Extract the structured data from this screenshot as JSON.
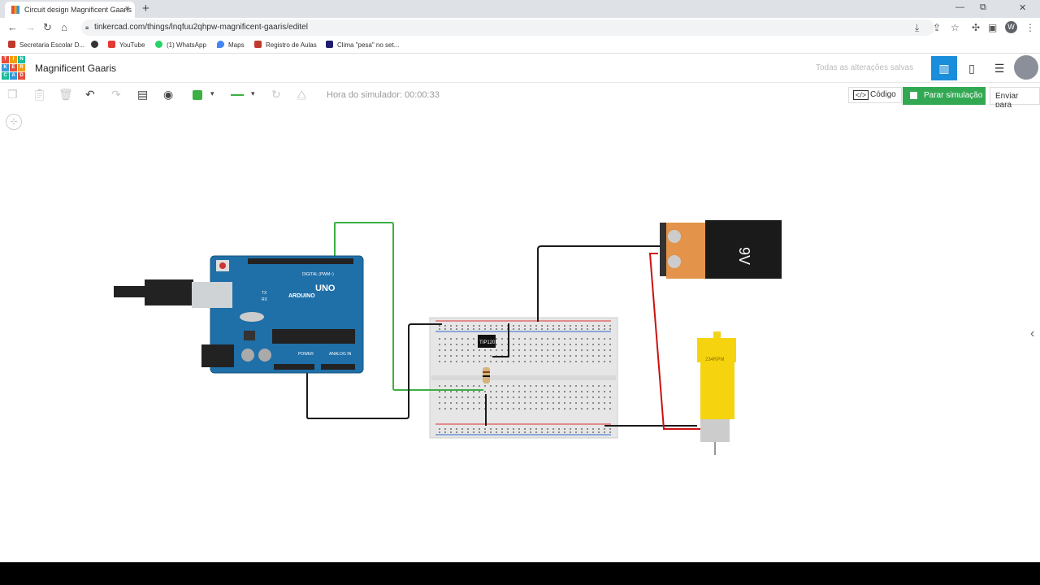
{
  "browser": {
    "tab_title": "Circuit design Magnificent Gaaris",
    "tab_close": "×",
    "new_tab": "+",
    "url": "tinkercad.com/things/lnqfuu2qhpw-magnificent-gaaris/editel",
    "avatar_letter": "W",
    "bookmarks": [
      {
        "label": "Secretaria Escolar D...",
        "color": "#c0392b"
      },
      {
        "label": "",
        "color": "#333333"
      },
      {
        "label": "YouTube",
        "color": "#e53935"
      },
      {
        "label": "(1) WhatsApp",
        "color": "#25d366"
      },
      {
        "label": "Maps",
        "color": "#4285f4"
      },
      {
        "label": "Registro de Aulas",
        "color": "#c0392b"
      },
      {
        "label": "Clima \"pesa\" no set...",
        "color": "#1e1e6e"
      }
    ]
  },
  "header": {
    "logo_letters": [
      "T",
      "I",
      "N",
      "K",
      "E",
      "R",
      "C",
      "A",
      "D"
    ],
    "logo_colors": [
      "#e74c3c",
      "#f39c12",
      "#1abc9c",
      "#3498db",
      "#e74c3c",
      "#f39c12",
      "#1abc9c",
      "#3498db",
      "#e74c3c"
    ],
    "project_title": "Magnificent Gaaris",
    "saved_status": "Todas as alterações salvas"
  },
  "toolbar": {
    "sim_time": "Hora do simulador: 00:00:33",
    "code_label": "Código",
    "code_icon": "</>",
    "sim_label": "Parar simulação",
    "send_label": "Enviar para",
    "sim_color": "#32a852",
    "color_swatch": "#3cb043"
  },
  "canvas": {
    "arduino": {
      "brand": "ARDUINO",
      "model": "UNO",
      "digital_label": "DIGITAL (PWM~)",
      "power_label": "POWER",
      "analog_label": "ANALOG IN",
      "tx": "TX",
      "rx": "RX"
    },
    "transistor_label": "TIP120",
    "battery_label": "9V",
    "motor_label": "234RPM",
    "wire_colors": {
      "green": "#3cb043",
      "black": "#1a1a1a",
      "red": "#cc1111"
    }
  }
}
